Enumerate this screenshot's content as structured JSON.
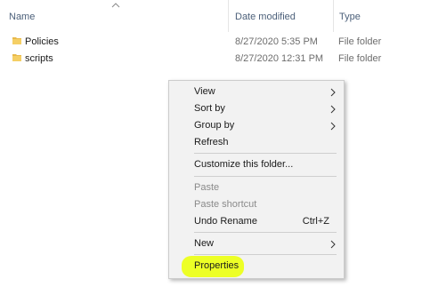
{
  "columns": {
    "name": "Name",
    "date_modified": "Date modified",
    "type": "Type"
  },
  "files": [
    {
      "name": "Policies",
      "date": "8/27/2020 5:35 PM",
      "type": "File folder",
      "icon": "folder-icon"
    },
    {
      "name": "scripts",
      "date": "8/27/2020 12:31 PM",
      "type": "File folder",
      "icon": "folder-icon"
    }
  ],
  "context_menu": {
    "view": "View",
    "sort_by": "Sort by",
    "group_by": "Group by",
    "refresh": "Refresh",
    "customize": "Customize this folder...",
    "paste": "Paste",
    "paste_shortcut": "Paste shortcut",
    "undo_rename": "Undo Rename",
    "undo_shortcut": "Ctrl+Z",
    "new": "New",
    "properties": "Properties"
  },
  "colors": {
    "highlight": "#ecff1a",
    "header_text": "#4c607a",
    "folder": "#e8b94a"
  }
}
